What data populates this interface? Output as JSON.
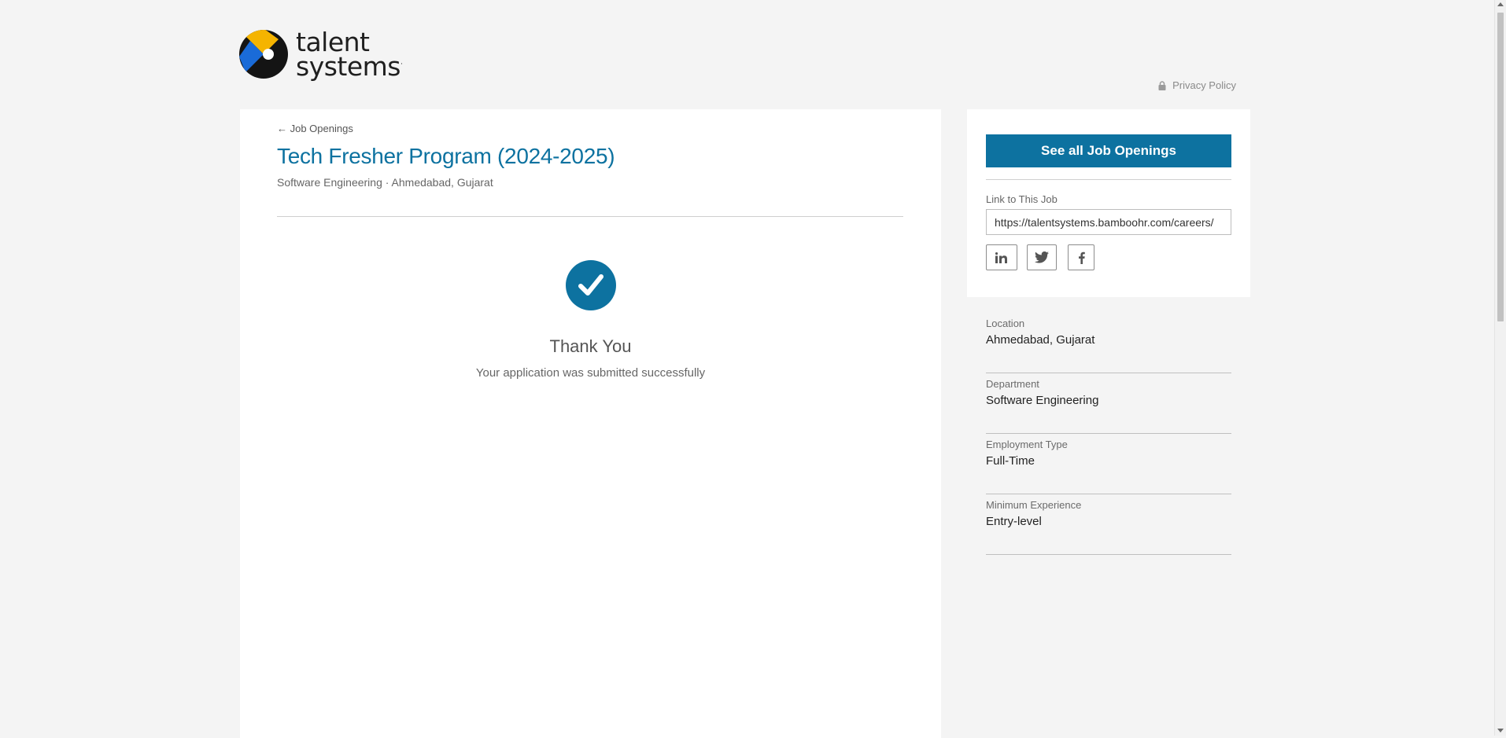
{
  "brand": {
    "logo_line1": "talent",
    "logo_line2": "systems",
    "logo_mark": "·"
  },
  "header": {
    "privacy_label": "Privacy Policy",
    "privacy_icon": "lock-icon"
  },
  "job": {
    "back_label": "← Job Openings",
    "title": "Tech Fresher Program (2024-2025)",
    "subtitle": "Software Engineering · Ahmedabad, Gujarat"
  },
  "confirmation": {
    "icon": "check-circle-icon",
    "heading": "Thank You",
    "message": "Your application was submitted successfully"
  },
  "sidebar": {
    "see_all_label": "See all Job Openings",
    "link_label": "Link to This Job",
    "link_value": "https://talentsystems.bamboohr.com/careers/",
    "share": [
      "linkedin-icon",
      "twitter-icon",
      "facebook-icon"
    ]
  },
  "details": [
    {
      "label": "Location",
      "value": "Ahmedabad, Gujarat"
    },
    {
      "label": "Department",
      "value": "Software Engineering"
    },
    {
      "label": "Employment Type",
      "value": "Full-Time"
    },
    {
      "label": "Minimum Experience",
      "value": "Entry-level"
    }
  ],
  "colors": {
    "accent": "#0d72a0",
    "background": "#f4f4f4",
    "logo_yellow": "#f5b400",
    "logo_blue": "#1a6bd8"
  }
}
